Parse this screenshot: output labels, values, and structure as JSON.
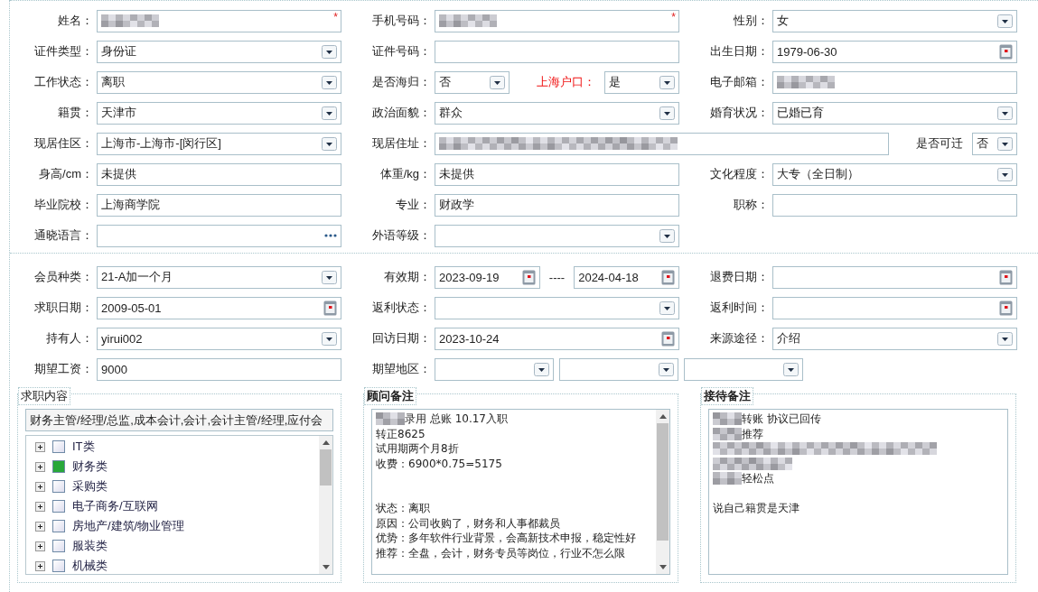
{
  "sections": [
    {
      "rows": [
        {
          "cells": [
            {
              "label": "姓名：",
              "controls": [
                {
                  "kind": "text",
                  "redacted": true,
                  "required_mark": "*"
                }
              ]
            },
            {
              "label": "手机号码：",
              "controls": [
                {
                  "kind": "text",
                  "redacted": true,
                  "required_mark": "*"
                }
              ]
            },
            {
              "label": "性别：",
              "controls": [
                {
                  "kind": "select",
                  "value": "女"
                }
              ]
            }
          ]
        },
        {
          "cells": [
            {
              "label": "证件类型：",
              "controls": [
                {
                  "kind": "select",
                  "value": "身份证"
                }
              ]
            },
            {
              "label": "证件号码：",
              "controls": [
                {
                  "kind": "text"
                }
              ]
            },
            {
              "label": "出生日期：",
              "controls": [
                {
                  "kind": "date",
                  "value": "1979-06-30"
                }
              ]
            }
          ]
        },
        {
          "cells": [
            {
              "label": "工作状态：",
              "controls": [
                {
                  "kind": "select",
                  "value": "离职"
                }
              ]
            },
            {
              "label": "是否海归：",
              "controls": [
                {
                  "kind": "select",
                  "value": "否"
                },
                {
                  "kind": "label",
                  "text": "上海户口：",
                  "emphasis": true
                },
                {
                  "kind": "select",
                  "value": "是"
                }
              ]
            },
            {
              "label": "电子邮箱：",
              "controls": [
                {
                  "kind": "text",
                  "redacted": true
                }
              ]
            }
          ]
        },
        {
          "cells": [
            {
              "label": "籍贯：",
              "controls": [
                {
                  "kind": "select",
                  "value": "天津市"
                }
              ]
            },
            {
              "label": "政治面貌：",
              "controls": [
                {
                  "kind": "select",
                  "value": "群众"
                }
              ]
            },
            {
              "label": "婚育状况：",
              "controls": [
                {
                  "kind": "select",
                  "value": "已婚已育"
                }
              ]
            }
          ]
        },
        {
          "cells": [
            {
              "label": "现居住区：",
              "controls": [
                {
                  "kind": "select",
                  "value": " 上海市-上海市-[闵行区]"
                }
              ]
            },
            {
              "label": "现居住址：",
              "controls": [
                {
                  "kind": "text",
                  "redacted": true
                },
                {
                  "kind": "label",
                  "text": "是否可迁",
                  "emphasis": false
                },
                {
                  "kind": "select",
                  "value": "否"
                }
              ]
            }
          ]
        },
        {
          "cells": [
            {
              "label": "身高/cm：",
              "controls": [
                {
                  "kind": "text",
                  "value": "未提供"
                }
              ]
            },
            {
              "label": "体重/kg：",
              "controls": [
                {
                  "kind": "text",
                  "value": "未提供"
                }
              ]
            },
            {
              "label": "文化程度：",
              "controls": [
                {
                  "kind": "select",
                  "value": "大专（全日制）"
                }
              ]
            }
          ]
        },
        {
          "cells": [
            {
              "label": "毕业院校：",
              "controls": [
                {
                  "kind": "text",
                  "value": "上海商学院"
                }
              ]
            },
            {
              "label": "专业：",
              "controls": [
                {
                  "kind": "text",
                  "value": "财政学"
                }
              ]
            },
            {
              "label": "职称：",
              "controls": [
                {
                  "kind": "text"
                }
              ]
            }
          ]
        },
        {
          "cells": [
            {
              "label": "通晓语言：",
              "controls": [
                {
                  "kind": "picker"
                }
              ]
            },
            {
              "label": "外语等级：",
              "controls": [
                {
                  "kind": "select"
                }
              ]
            }
          ]
        }
      ]
    },
    {
      "rows": [
        {
          "cells": [
            {
              "label": "会员种类：",
              "controls": [
                {
                  "kind": "select",
                  "value": " 21-A加一个月"
                }
              ]
            },
            {
              "label": "有效期：",
              "controls": [
                {
                  "kind": "date",
                  "value": "2023-09-19"
                },
                {
                  "kind": "separator",
                  "text": "----"
                },
                {
                  "kind": "date",
                  "value": "2024-04-18"
                }
              ]
            },
            {
              "label": "退费日期：",
              "controls": [
                {
                  "kind": "date"
                }
              ]
            }
          ]
        },
        {
          "cells": [
            {
              "label": "求职日期：",
              "controls": [
                {
                  "kind": "date",
                  "value": "2009-05-01"
                }
              ]
            },
            {
              "label": "返利状态：",
              "controls": [
                {
                  "kind": "select"
                }
              ]
            },
            {
              "label": "返利时间：",
              "controls": [
                {
                  "kind": "date"
                }
              ]
            }
          ]
        },
        {
          "cells": [
            {
              "label": "持有人：",
              "controls": [
                {
                  "kind": "select",
                  "value": "yirui002"
                }
              ]
            },
            {
              "label": "回访日期：",
              "controls": [
                {
                  "kind": "date",
                  "value": "2023-10-24"
                }
              ]
            },
            {
              "label": "来源途径：",
              "controls": [
                {
                  "kind": "select",
                  "value": "介绍"
                }
              ]
            }
          ]
        },
        {
          "cells": [
            {
              "label": "期望工资：",
              "controls": [
                {
                  "kind": "text",
                  "value": "9000"
                }
              ]
            },
            {
              "label": "期望地区：",
              "controls": [
                {
                  "kind": "select"
                },
                {
                  "kind": "select"
                },
                {
                  "kind": "select"
                }
              ]
            }
          ]
        }
      ]
    }
  ],
  "groups": [
    {
      "kind": "tree",
      "legend": "求职内容",
      "emphasis": false,
      "summary": "财务主管/经理/总监,成本会计,会计,会计主管/经理,应付会",
      "items": [
        {
          "label": "IT类",
          "checked": false,
          "expanded": false
        },
        {
          "label": "财务类",
          "checked": true,
          "expanded": false
        },
        {
          "label": "采购类",
          "checked": false,
          "expanded": false
        },
        {
          "label": "电子商务/互联网",
          "checked": false,
          "expanded": false
        },
        {
          "label": "房地产/建筑/物业管理",
          "checked": false,
          "expanded": false
        },
        {
          "label": "服装类",
          "checked": false,
          "expanded": false
        },
        {
          "label": "机械类",
          "checked": false,
          "expanded": false
        }
      ]
    },
    {
      "kind": "notes",
      "legend": "顾问备注",
      "emphasis": true,
      "scrollable": true,
      "lines": [
        {
          "kind": "text",
          "redacted": true,
          "text": "录用 总账  10.17入职"
        },
        {
          "kind": "text",
          "text": "转正8625"
        },
        {
          "kind": "text",
          "text": "试用期两个月8折"
        },
        {
          "kind": "text",
          "text": "收费：6900*0.75=5175"
        },
        {
          "kind": "blank"
        },
        {
          "kind": "blank"
        },
        {
          "kind": "text",
          "text": "状态：离职"
        },
        {
          "kind": "text",
          "text": "原因：公司收购了，财务和人事都裁员"
        },
        {
          "kind": "text",
          "text": "优势：多年软件行业背景，会高新技术申报，稳定性好"
        },
        {
          "kind": "text",
          "text": "推荐：全盘，会计，财务专员等岗位，行业不怎么限"
        }
      ]
    },
    {
      "kind": "notes",
      "legend": "接待备注",
      "emphasis": true,
      "scrollable": false,
      "lines": [
        {
          "kind": "text",
          "redacted": true,
          "text": " 转账 协议已回传"
        },
        {
          "kind": "text",
          "redacted": true,
          "text": "推荐"
        },
        {
          "kind": "redacted"
        },
        {
          "kind": "text",
          "redacted": true,
          "text": "轻松点"
        },
        {
          "kind": "blank"
        },
        {
          "kind": "text",
          "text": "说自己籍贯是天津"
        }
      ]
    }
  ]
}
